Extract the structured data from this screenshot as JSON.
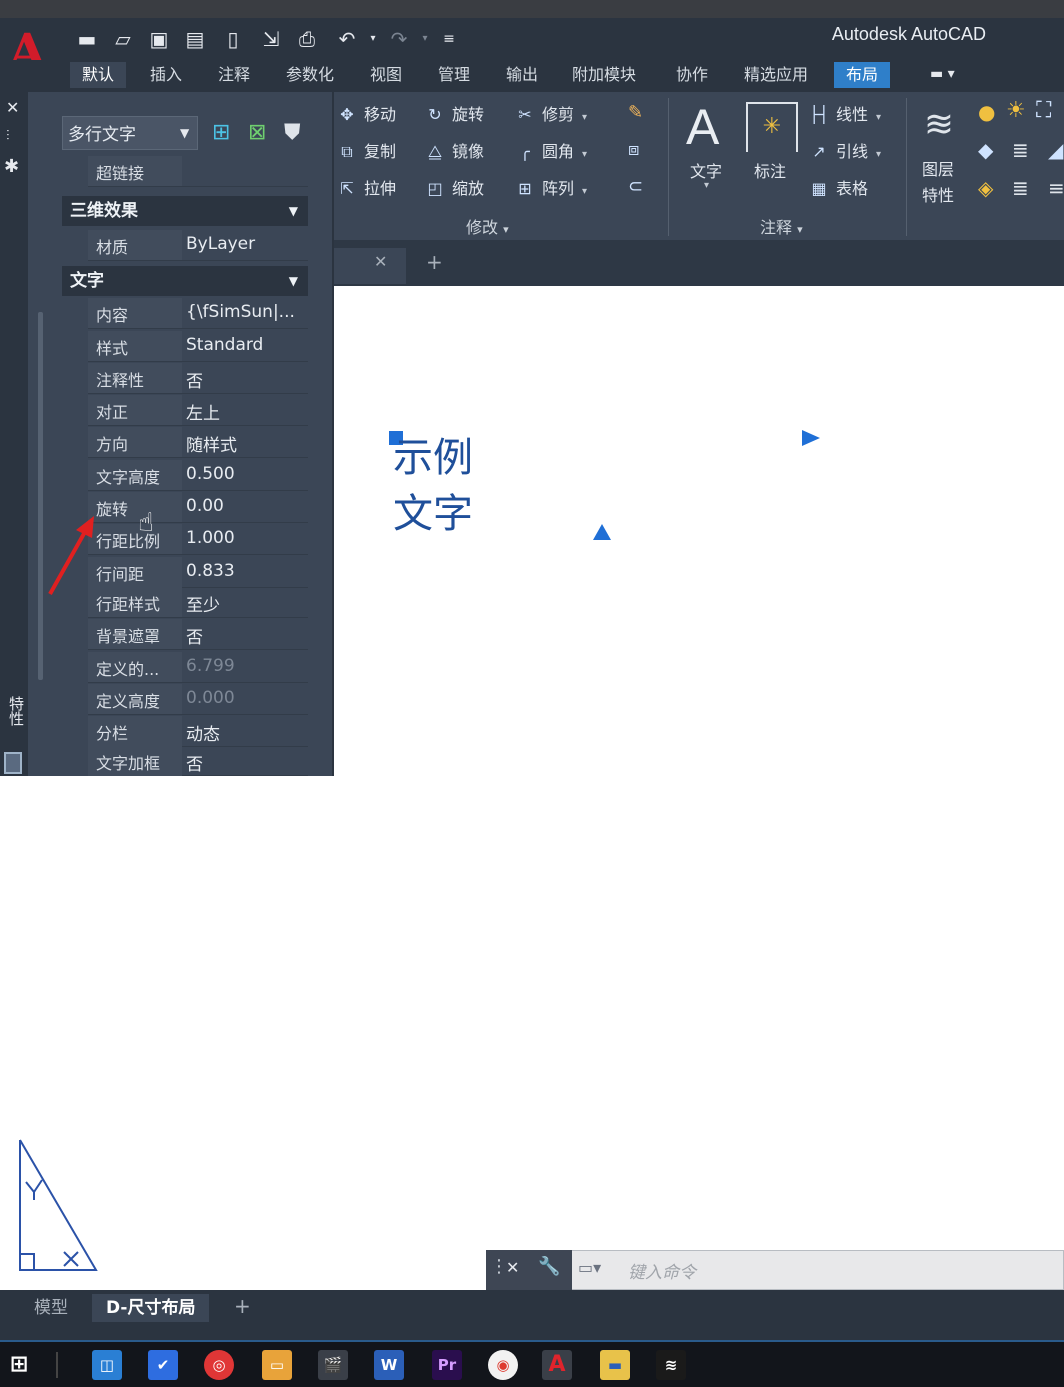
{
  "app": {
    "title": "Autodesk AutoCAD",
    "logo_letter": "A",
    "accent": "#d21c2a"
  },
  "quick_access": [
    "new-icon",
    "open-icon",
    "save-icon",
    "save-as-icon",
    "publish-icon",
    "import-icon",
    "plot-icon",
    "undo-icon",
    "redo-icon",
    "customize-icon"
  ],
  "ribbon_tabs": [
    "默认",
    "插入",
    "注释",
    "参数化",
    "视图",
    "管理",
    "输出",
    "附加模块",
    "协作",
    "精选应用",
    "布局"
  ],
  "ribbon": {
    "modify": {
      "title": "修改",
      "items": [
        "移动",
        "旋转",
        "修剪",
        "复制",
        "镜像",
        "圆角",
        "拉伸",
        "缩放",
        "阵列"
      ]
    },
    "annotation": {
      "title": "注释",
      "text_label": "文字",
      "dim_label": "标注",
      "linear": "线性",
      "leader": "引线",
      "table": "表格"
    },
    "layers": {
      "label_line1": "图层",
      "label_line2": "特性"
    }
  },
  "properties": {
    "object_type": "多行文字",
    "hyperlink_label": "超链接",
    "section_3d": "三维效果",
    "material_label": "材质",
    "material_value": "ByLayer",
    "section_text": "文字",
    "rows": [
      {
        "label": "内容",
        "value": "{\\fSimSun|...",
        "dim": false
      },
      {
        "label": "样式",
        "value": "Standard",
        "dim": false
      },
      {
        "label": "注释性",
        "value": "否",
        "dim": false
      },
      {
        "label": "对正",
        "value": "左上",
        "dim": false
      },
      {
        "label": "方向",
        "value": "随样式",
        "dim": false
      },
      {
        "label": "文字高度",
        "value": "0.500",
        "dim": false
      },
      {
        "label": "旋转",
        "value": "0.00",
        "dim": false
      },
      {
        "label": "行距比例",
        "value": "1.000",
        "dim": false
      },
      {
        "label": "行间距",
        "value": "0.833",
        "dim": false
      },
      {
        "label": "行距样式",
        "value": "至少",
        "dim": false
      },
      {
        "label": "背景遮罩",
        "value": "否",
        "dim": false
      },
      {
        "label": "定义的...",
        "value": "6.799",
        "dim": true
      },
      {
        "label": "定义高度",
        "value": "0.000",
        "dim": true
      },
      {
        "label": "分栏",
        "value": "动态",
        "dim": false
      },
      {
        "label": "文字加框",
        "value": "否",
        "dim": false
      }
    ],
    "side_label": "特性"
  },
  "canvas": {
    "mtext_line1": "示例",
    "mtext_line2": "文字",
    "grip_color": "#1f6fd6",
    "text_color": "#1f4f9a"
  },
  "command": {
    "placeholder": "键入命令"
  },
  "layout_tabs": [
    "模型",
    "D-尺寸布局"
  ],
  "taskbar": [
    "windows-start-icon",
    "tencent-meeting-icon",
    "feishu-icon",
    "netease-music-icon",
    "slides-icon",
    "video-editor-icon",
    "word-icon",
    "premiere-icon",
    "chrome-icon",
    "autocad-icon",
    "file-explorer-icon",
    "capcut-icon"
  ]
}
